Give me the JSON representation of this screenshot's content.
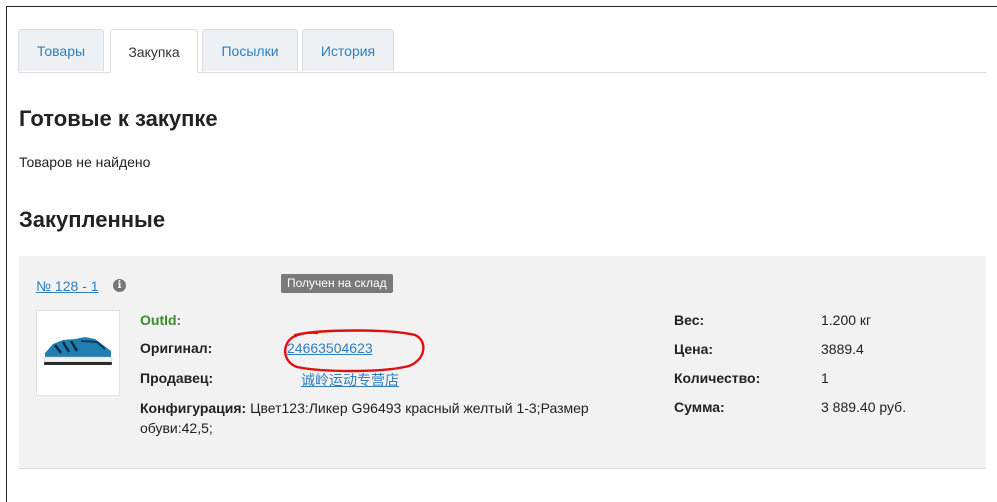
{
  "tabs": [
    {
      "label": "Товары"
    },
    {
      "label": "Закупка"
    },
    {
      "label": "Посылки"
    },
    {
      "label": "История"
    }
  ],
  "active_tab": "Закупка",
  "sections": {
    "ready_title": "Готовые к закупке",
    "ready_empty": "Товаров не найдено",
    "bought_title": "Закупленные"
  },
  "order": {
    "number": "№ 128 - 1",
    "info_icon": "i",
    "status": "Получен на склад",
    "outid_label": "OutId:",
    "original_label": "Оригинал:",
    "original_value": "24663504623",
    "seller_label": "Продавец:",
    "seller_value": "诚岭运动专营店",
    "config_label": "Конфигурация:",
    "config_value": "Цвет123:Ликер G96493 красный желтый 1-3;Размер обуви:42,5;",
    "weight_label": "Вес:",
    "weight_value": "1.200 кг",
    "price_label": "Цена:",
    "price_value": "3889.4",
    "qty_label": "Количество:",
    "qty_value": "1",
    "sum_label": "Сумма:",
    "sum_value": "3 889.40 руб."
  },
  "colors": {
    "link": "#2f7ebf",
    "outid": "#3a8b2c",
    "badge": "#7a7a7a",
    "annotation": "#e01010"
  }
}
